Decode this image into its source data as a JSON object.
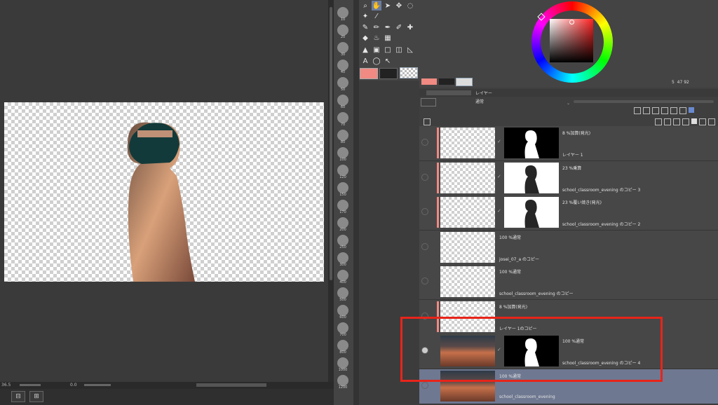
{
  "status": {
    "zoom": "36.5",
    "angle": "0.0"
  },
  "brush_sizes": [
    "10",
    "20",
    "30",
    "40",
    "50",
    "60",
    "70",
    "80",
    "100",
    "120",
    "150",
    "170",
    "200",
    "250",
    "300",
    "400",
    "500",
    "600",
    "700",
    "800",
    "1000",
    "1200"
  ],
  "color_info": {
    "values": [
      "5",
      "47",
      "92"
    ]
  },
  "colors": {
    "main": "#f08a82",
    "sub": "#222222",
    "accent_red": "#e8241a",
    "selected_row": "#6e7891"
  },
  "layer_panel": {
    "tabs": [
      "レイヤー"
    ],
    "blend_mode": "通常",
    "layers": [
      {
        "blend": "8 %加算(発光)",
        "name": "レイヤー 1",
        "mask": true
      },
      {
        "blend": "23 %乗算",
        "name": "school_classroom_evening のコピー 3",
        "mask": true
      },
      {
        "blend": "23 %覆い焼き(発光)",
        "name": "school_classroom_evening のコピー 2",
        "mask": true
      },
      {
        "blend": "100 %通常",
        "name": "josei_07_a のコピー",
        "mask": false
      },
      {
        "blend": "100 %通常",
        "name": "school_classroom_evening のコピー",
        "mask": false
      },
      {
        "blend": "8 %加算(発光)",
        "name": "レイヤー 1のコピー",
        "mask": false
      },
      {
        "blend": "100 %通常",
        "name": "school_classroom_evening のコピー 4",
        "mask": true
      },
      {
        "blend": "100 %通常",
        "name": "school_classroom_evening",
        "mask": false
      }
    ]
  }
}
